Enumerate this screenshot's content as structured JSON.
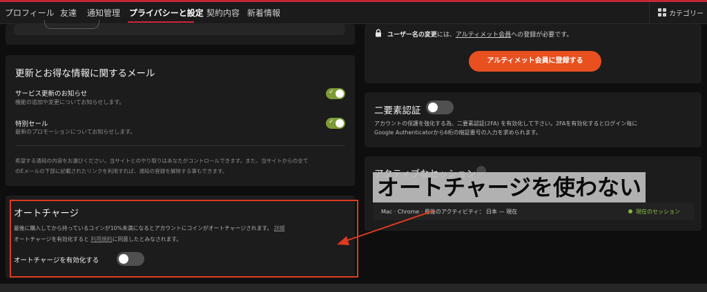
{
  "nav": {
    "tabs": [
      "プロフィール",
      "友達",
      "通知管理",
      "プライバシーと設定",
      "契約内容",
      "新着情報"
    ],
    "active_tab": "プライバシーと設定",
    "category_label": "カテゴリー"
  },
  "username_change": {
    "prefix": "ユーザー名の変更",
    "middle": "には、",
    "link": "アルティメット会員",
    "suffix": "への登録が必要です。",
    "button": "アルティメット会員に登録する"
  },
  "emails": {
    "title": "更新とお得な情報に関するメール",
    "items": [
      {
        "title": "サービス更新のお知らせ",
        "desc": "機能の追加や変更についてお知らせします。",
        "enabled": true
      },
      {
        "title": "特別セール",
        "desc": "最新のプロモーションについてお知らせします。",
        "enabled": true
      }
    ],
    "note_line1": "希望する通知の内容をお選びください。当サイトとのやり取りはあなたがコントロールできます。また、当サイトからの全て",
    "note_line2": "のEメールの下部に記載されたリンクを利用すれば、通知の登録を解除する事もできます。"
  },
  "two_factor": {
    "title": "二要素認証",
    "enabled": false,
    "desc_line1": "アカウントの保護を強化する為、二要素認証(2FA) を有効化して下さい。2FAを有効化するとログイン毎に",
    "desc_line2": "Google Authenticatorから6桁の暗証番号の入力を求められます。"
  },
  "sessions": {
    "title": "アクティブなセッション",
    "row": "Mac · Chrome · 最後のアクティビティ： 日本 — 現在",
    "current": "現在のセッション"
  },
  "autocharge": {
    "title": "オートチャージ",
    "line1": "最後に購入してから持っているコインが10%未満になるとアカウントにコインがオートチャージされます。",
    "line1_link": "詳細",
    "line2_prefix": "オートチャージを有効化すると",
    "line2_link": "利用規約",
    "line2_suffix": "に同意したとみなされます。",
    "toggle_label": "オートチャージを有効化する",
    "enabled": false
  },
  "annotation": {
    "text": "オートチャージを使わない"
  },
  "colors": {
    "accent_red": "#d1263c",
    "orange": "#e8501f",
    "toggle_green": "#7d9b35",
    "annotation_red": "#e03a1e"
  }
}
